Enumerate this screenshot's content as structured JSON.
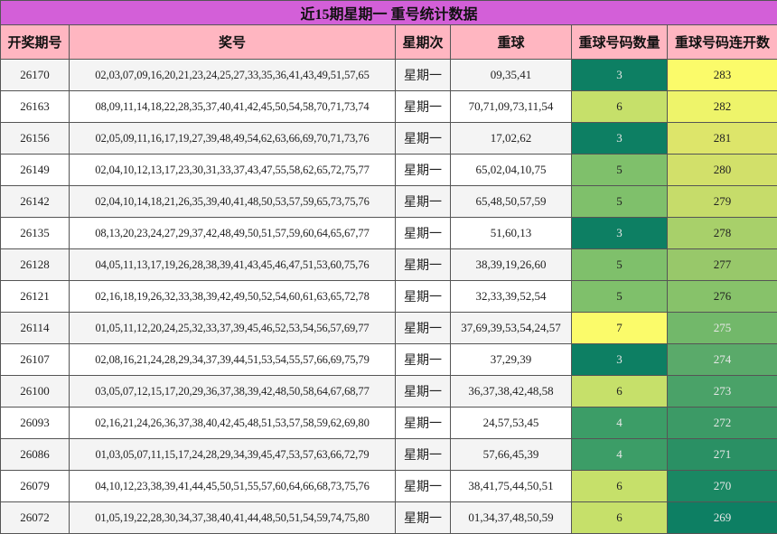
{
  "title": "近15期星期一 重号统计数据",
  "headers": [
    "开奖期号",
    "奖号",
    "星期次",
    "重球",
    "重球号码数量",
    "重球号码连开数"
  ],
  "colors": {
    "title_bg": "#d35fd8",
    "header_bg": "#ffb6c1",
    "dark_green": "#0d7f63",
    "mid_green": "#3c9d67",
    "green": "#5aaa6a",
    "light_green": "#7fc06b",
    "yellow_green": "#c6e06a",
    "pale_yellow_green": "#dde56a",
    "yellow": "#fbfb6a"
  },
  "rows": [
    {
      "issue": "26170",
      "numbers": "02,03,07,09,16,20,21,23,24,25,27,33,35,36,41,43,49,51,57,65",
      "weekday": "星期一",
      "repeats": "09,35,41",
      "count": "3",
      "count_color": "#0d7f63",
      "count_text_color": "#e8e8e8",
      "streak": "283",
      "streak_color": "#fbfb6a",
      "streak_text_color": "#222222"
    },
    {
      "issue": "26163",
      "numbers": "08,09,11,14,18,22,28,35,37,40,41,42,45,50,54,58,70,71,73,74",
      "weekday": "星期一",
      "repeats": "70,71,09,73,11,54",
      "count": "6",
      "count_color": "#c6e06a",
      "count_text_color": "#222222",
      "streak": "282",
      "streak_color": "#eef46a",
      "streak_text_color": "#222222"
    },
    {
      "issue": "26156",
      "numbers": "02,05,09,11,16,17,19,27,39,48,49,54,62,63,66,69,70,71,73,76",
      "weekday": "星期一",
      "repeats": "17,02,62",
      "count": "3",
      "count_color": "#0d7f63",
      "count_text_color": "#e8e8e8",
      "streak": "281",
      "streak_color": "#dde56a",
      "streak_text_color": "#222222"
    },
    {
      "issue": "26149",
      "numbers": "02,04,10,12,13,17,23,30,31,33,37,43,47,55,58,62,65,72,75,77",
      "weekday": "星期一",
      "repeats": "65,02,04,10,75",
      "count": "5",
      "count_color": "#7fc06b",
      "count_text_color": "#222222",
      "streak": "280",
      "streak_color": "#d2e06a",
      "streak_text_color": "#222222"
    },
    {
      "issue": "26142",
      "numbers": "02,04,10,14,18,21,26,35,39,40,41,48,50,53,57,59,65,73,75,76",
      "weekday": "星期一",
      "repeats": "65,48,50,57,59",
      "count": "5",
      "count_color": "#7fc06b",
      "count_text_color": "#222222",
      "streak": "279",
      "streak_color": "#c6dc6a",
      "streak_text_color": "#222222"
    },
    {
      "issue": "26135",
      "numbers": "08,13,20,23,24,27,29,37,42,48,49,50,51,57,59,60,64,65,67,77",
      "weekday": "星期一",
      "repeats": "51,60,13",
      "count": "3",
      "count_color": "#0d7f63",
      "count_text_color": "#e8e8e8",
      "streak": "278",
      "streak_color": "#a8d06a",
      "streak_text_color": "#222222"
    },
    {
      "issue": "26128",
      "numbers": "04,05,11,13,17,19,26,28,38,39,41,43,45,46,47,51,53,60,75,76",
      "weekday": "星期一",
      "repeats": "38,39,19,26,60",
      "count": "5",
      "count_color": "#7fc06b",
      "count_text_color": "#222222",
      "streak": "277",
      "streak_color": "#98c86a",
      "streak_text_color": "#222222"
    },
    {
      "issue": "26121",
      "numbers": "02,16,18,19,26,32,33,38,39,42,49,50,52,54,60,61,63,65,72,78",
      "weekday": "星期一",
      "repeats": "32,33,39,52,54",
      "count": "5",
      "count_color": "#7fc06b",
      "count_text_color": "#222222",
      "streak": "276",
      "streak_color": "#87c26a",
      "streak_text_color": "#222222"
    },
    {
      "issue": "26114",
      "numbers": "01,05,11,12,20,24,25,32,33,37,39,45,46,52,53,54,56,57,69,77",
      "weekday": "星期一",
      "repeats": "37,69,39,53,54,24,57",
      "count": "7",
      "count_color": "#fbfb6a",
      "count_text_color": "#222222",
      "streak": "275",
      "streak_color": "#72b86a",
      "streak_text_color": "#e8e8e8"
    },
    {
      "issue": "26107",
      "numbers": "02,08,16,21,24,28,29,34,37,39,44,51,53,54,55,57,66,69,75,79",
      "weekday": "星期一",
      "repeats": "37,29,39",
      "count": "3",
      "count_color": "#0d7f63",
      "count_text_color": "#e8e8e8",
      "streak": "274",
      "streak_color": "#5aaa6a",
      "streak_text_color": "#e8e8e8"
    },
    {
      "issue": "26100",
      "numbers": "03,05,07,12,15,17,20,29,36,37,38,39,42,48,50,58,64,67,68,77",
      "weekday": "星期一",
      "repeats": "36,37,38,42,48,58",
      "count": "6",
      "count_color": "#c6e06a",
      "count_text_color": "#222222",
      "streak": "273",
      "streak_color": "#4aa268",
      "streak_text_color": "#e8e8e8"
    },
    {
      "issue": "26093",
      "numbers": "02,16,21,24,26,36,37,38,40,42,45,48,51,53,57,58,59,62,69,80",
      "weekday": "星期一",
      "repeats": "24,57,53,45",
      "count": "4",
      "count_color": "#3c9d67",
      "count_text_color": "#e8e8e8",
      "streak": "272",
      "streak_color": "#3c9a66",
      "streak_text_color": "#e8e8e8"
    },
    {
      "issue": "26086",
      "numbers": "01,03,05,07,11,15,17,24,28,29,34,39,45,47,53,57,63,66,72,79",
      "weekday": "星期一",
      "repeats": "57,66,45,39",
      "count": "4",
      "count_color": "#3c9d67",
      "count_text_color": "#e8e8e8",
      "streak": "271",
      "streak_color": "#2a9064",
      "streak_text_color": "#e8e8e8"
    },
    {
      "issue": "26079",
      "numbers": "04,10,12,23,38,39,41,44,45,50,51,55,57,60,64,66,68,73,75,76",
      "weekday": "星期一",
      "repeats": "38,41,75,44,50,51",
      "count": "6",
      "count_color": "#c6e06a",
      "count_text_color": "#222222",
      "streak": "270",
      "streak_color": "#1a8863",
      "streak_text_color": "#e8e8e8"
    },
    {
      "issue": "26072",
      "numbers": "01,05,19,22,28,30,34,37,38,40,41,44,48,50,51,54,59,74,75,80",
      "weekday": "星期一",
      "repeats": "01,34,37,48,50,59",
      "count": "6",
      "count_color": "#c6e06a",
      "count_text_color": "#222222",
      "streak": "269",
      "streak_color": "#0d7f63",
      "streak_text_color": "#e8e8e8"
    }
  ]
}
